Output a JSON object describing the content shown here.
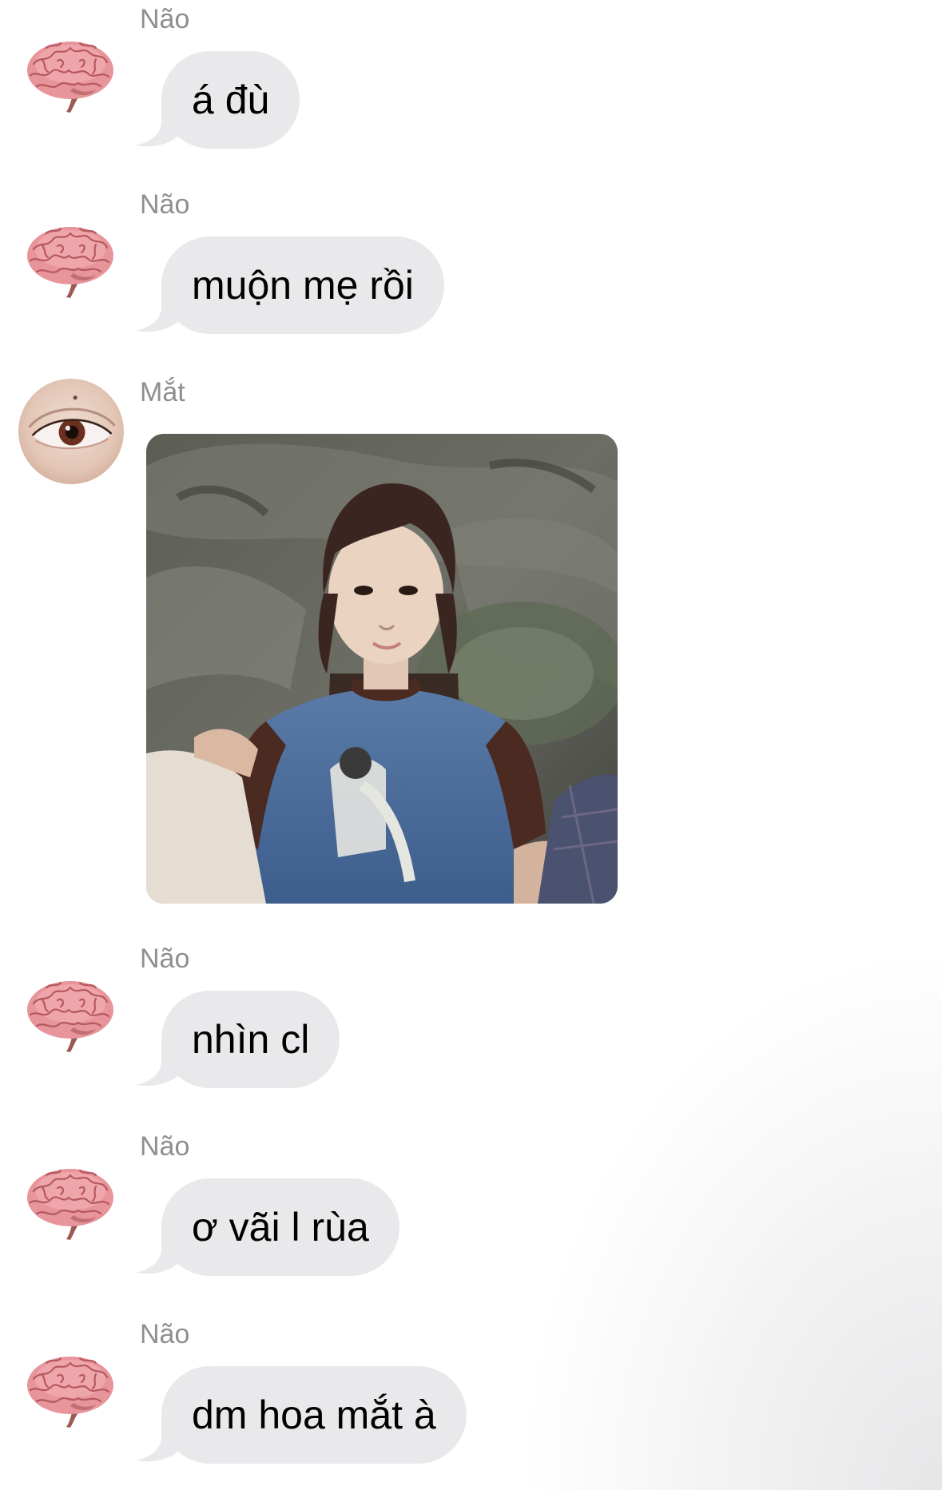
{
  "conversation": {
    "messages": [
      {
        "sender": "Não",
        "avatar": "brain-icon",
        "text": "á đù"
      },
      {
        "sender": "Não",
        "avatar": "brain-icon",
        "text": "muộn mẹ rồi"
      },
      {
        "sender": "Mắt",
        "avatar": "eye-icon",
        "type": "image"
      },
      {
        "sender": "Não",
        "avatar": "brain-icon",
        "text": "nhìn cl"
      },
      {
        "sender": "Não",
        "avatar": "brain-icon",
        "text": "ơ vãi l rùa"
      },
      {
        "sender": "Não",
        "avatar": "brain-icon",
        "text": "dm hoa mắt à"
      }
    ]
  },
  "colors": {
    "bubble": "#e9e9eb",
    "sender_name": "#8e8e93",
    "text": "#000000",
    "background": "#ffffff"
  }
}
